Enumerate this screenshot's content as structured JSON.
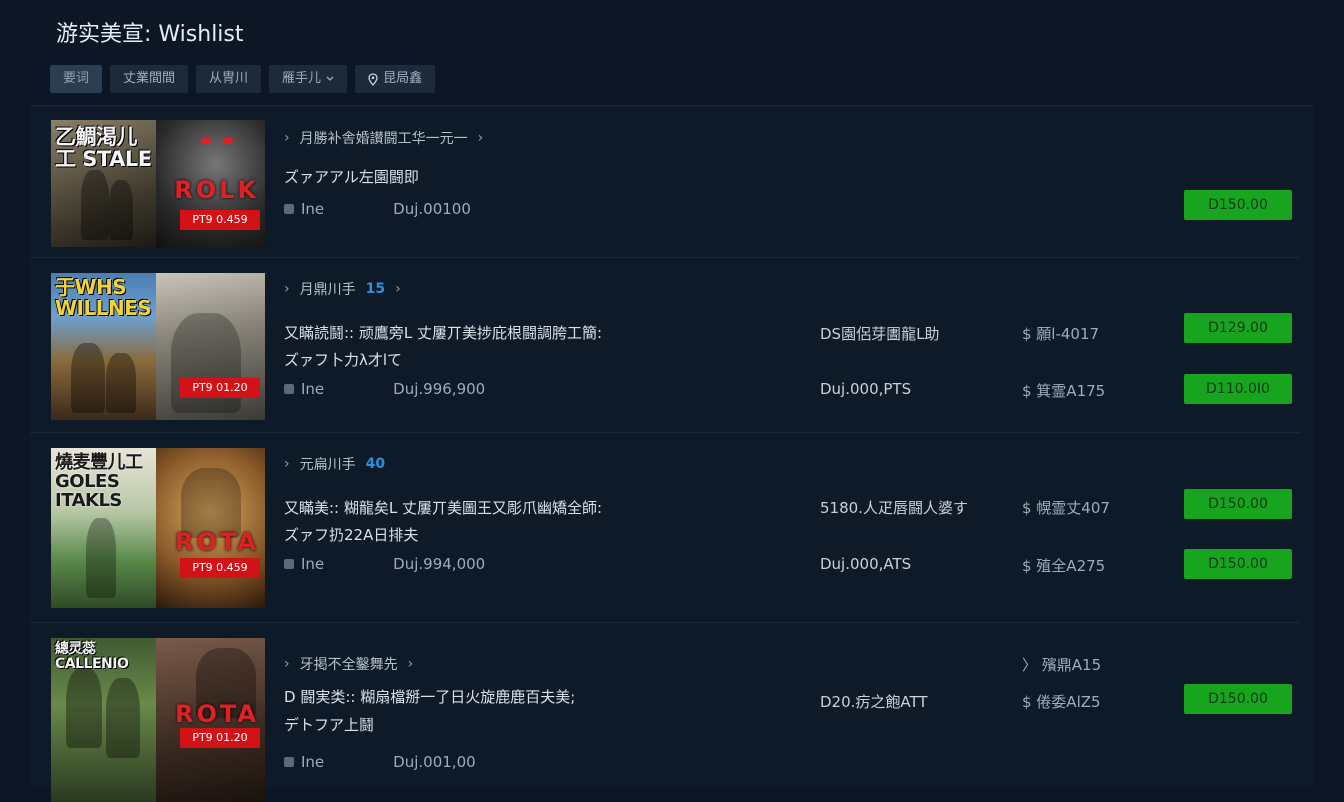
{
  "header": {
    "title": "游实美宣: Wishlist"
  },
  "toolbar": [
    {
      "label": "要词",
      "icon": ""
    },
    {
      "label": "丈業間間",
      "icon": ""
    },
    {
      "label": "从冑川",
      "icon": ""
    },
    {
      "label": "雁手儿",
      "icon": "chevron-down-icon"
    },
    {
      "label": "昆局鑫",
      "icon": "location-pin-icon"
    }
  ],
  "items": [
    {
      "art_a": {
        "title": "乙鯛渇儿工 STALE",
        "colors": [
          "#6b6452",
          "#2a2620"
        ]
      },
      "art_b": {
        "red_text": "ROLK",
        "price_tag": "PT9 0.459",
        "colors": [
          "#5a5a5a",
          "#1a1a1a"
        ]
      },
      "tag": "月勝补舎婚讃闘工华一元一",
      "count": "",
      "desc": [
        "ズァアアル左園闘即"
      ],
      "meta_label": "Ine",
      "meta_value": "Duj.00100",
      "col2": [],
      "col3": [],
      "buttons": [
        "D150.00"
      ]
    },
    {
      "art_a": {
        "title": "于WHS WILLNES",
        "colors": [
          "#3b6b9a",
          "#6d4a2a"
        ]
      },
      "art_b": {
        "red_text": "",
        "price_tag": "PT9 01.20",
        "colors": [
          "#7b7b6f",
          "#3a3a30"
        ]
      },
      "tag": "月鼎川手",
      "count": "15",
      "desc": [
        "又瞞読鬪:: 顽鷹旁L 丈屢丌美捗庇根闘調胯工簡:",
        "ズァフ卜力λ才lて"
      ],
      "meta_label": "Ine",
      "meta_value": "Duj.996,900",
      "col2": [
        "DS園侶芽圕龍L助",
        "Duj.000,PTS"
      ],
      "col3": [
        "$ 願l-4017",
        "$ 箕霊A175"
      ],
      "buttons": [
        "D129.00",
        "D110.0I0"
      ]
    },
    {
      "art_a": {
        "title": "燒麦豐儿工 GOLES ITAKLS",
        "colors": [
          "#5a8a4a",
          "#c9a36a"
        ]
      },
      "art_b": {
        "red_text": "ROTA",
        "price_tag": "PT9 0.459",
        "colors": [
          "#c8963f",
          "#4a2e15"
        ]
      },
      "tag": "元扁川手",
      "count": "40",
      "desc": [
        "又瞞美:: 糊龍矣L 丈屢丌美圖王又彫爪幽矯全師:",
        "ズァフ扔22A日排夫"
      ],
      "meta_label": "Ine",
      "meta_value": "Duj.994,000",
      "col2": [
        "5180.人疋唇闘人婆す",
        "Duj.000,ATS"
      ],
      "col3": [
        "$ 幌霊丈407",
        "$ 殖全A275"
      ],
      "buttons": [
        "D150.00",
        "D150.00"
      ]
    },
    {
      "art_a": {
        "title": "總灵蕊 CALLENIO",
        "colors": [
          "#4a6a3a",
          "#2a3a20"
        ]
      },
      "art_b": {
        "red_text": "ROTA",
        "price_tag": "PT9 01.20",
        "colors": [
          "#6a4a3a",
          "#2a1a15"
        ]
      },
      "tag": "牙掲不全鑿舞先",
      "count": "",
      "desc": [
        "D 闘実类:: 糊扇檔掰一了日火旋鹿鹿百夫美;",
        "デトフア上鬪"
      ],
      "meta_label": "Ine",
      "meta_value": "Duj.001,00",
      "col2": [
        "D20.疠之飽ATT"
      ],
      "col3": [
        "$ 倦委AlZ5"
      ],
      "col3_top": "〉 殯鼎A15",
      "buttons": [
        "D150.00"
      ]
    }
  ]
}
